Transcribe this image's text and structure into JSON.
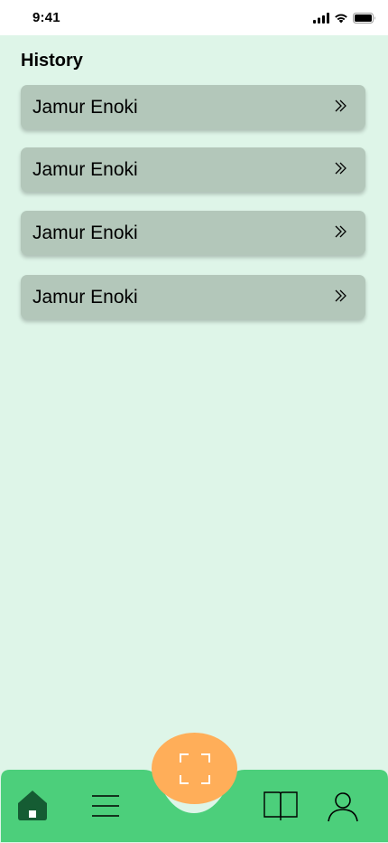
{
  "status_bar": {
    "time": "9:41",
    "icons": [
      "signal-icon",
      "wifi-icon",
      "battery-icon"
    ]
  },
  "page": {
    "title": "History"
  },
  "history": {
    "items": [
      {
        "label": "Jamur Enoki",
        "icon": "double-chevron-right-icon"
      },
      {
        "label": "Jamur Enoki",
        "icon": "double-chevron-right-icon"
      },
      {
        "label": "Jamur Enoki",
        "icon": "double-chevron-right-icon"
      },
      {
        "label": "Jamur Enoki",
        "icon": "double-chevron-right-icon"
      }
    ]
  },
  "bottom_nav": {
    "items": [
      {
        "icon": "home-icon",
        "active": true
      },
      {
        "icon": "menu-icon",
        "active": false
      },
      {
        "icon": "scan-icon",
        "active": false
      },
      {
        "icon": "book-icon",
        "active": false
      },
      {
        "icon": "profile-icon",
        "active": false
      }
    ]
  },
  "colors": {
    "background": "#def5e8",
    "card": "#b3c7ba",
    "nav": "#4ccf7b",
    "scan_button": "#ffae59",
    "home_active": "#155c33"
  }
}
